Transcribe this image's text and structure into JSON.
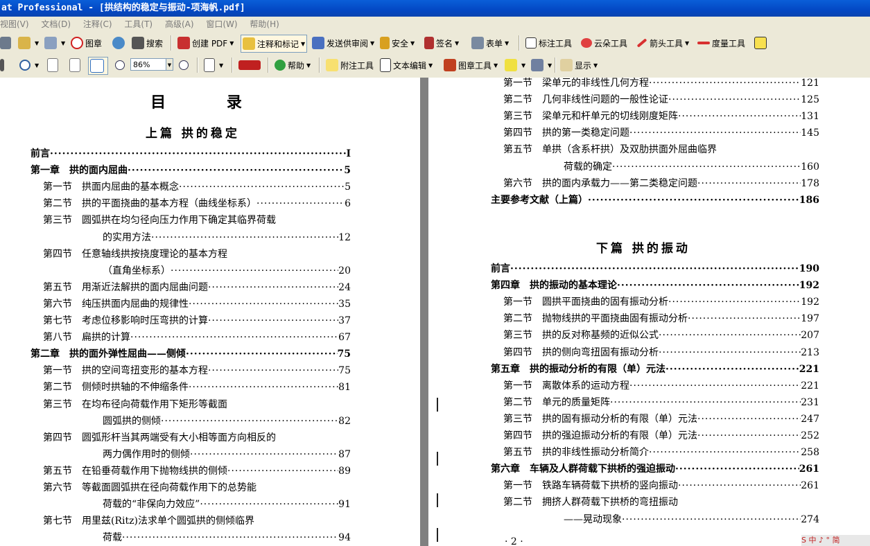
{
  "window": {
    "title": "at Professional - [拱结构的稳定与振动-项海帆.pdf]"
  },
  "menu": [
    "视图(V)",
    "文档(D)",
    "注释(C)",
    "工具(T)",
    "高级(A)",
    "窗口(W)",
    "帮助(H)"
  ],
  "toolbar1": {
    "stamp": "图章",
    "search": "搜索",
    "create_pdf": "创建 PDF",
    "comment_markup": "注释和标记",
    "send_review": "发送供审阅",
    "security": "安全",
    "sign": "签名",
    "forms": "表单",
    "callout": "标注工具",
    "cloud": "云朵工具",
    "arrow": "箭头工具",
    "measure": "度量工具"
  },
  "toolbar2": {
    "zoom_value": "86%",
    "help": "帮助",
    "note_tool": "附注工具",
    "text_edit": "文本编辑",
    "stamp_tool": "图章工具",
    "show": "显示"
  },
  "left_page": {
    "title": "目 录",
    "part_title": "上篇 拱的稳定",
    "entries": [
      {
        "label": "前言",
        "text": "",
        "page": "I",
        "bold": true
      },
      {
        "label": "第一章",
        "text": "拱的面内屈曲",
        "page": "5",
        "bold": true
      },
      {
        "label": "第一节",
        "text": "拱面内屈曲的基本概念",
        "page": "5"
      },
      {
        "label": "第二节",
        "text": "拱的平面挠曲的基本方程（曲线坐标系）",
        "page": "6"
      },
      {
        "label": "第三节",
        "text": "圆弧拱在均匀径向压力作用下确定其临界荷载",
        "page": ""
      },
      {
        "label": "",
        "text": "的实用方法",
        "page": "12"
      },
      {
        "label": "第四节",
        "text": "任意轴线拱按挠度理论的基本方程",
        "page": ""
      },
      {
        "label": "",
        "text": "（直角坐标系）",
        "page": "20"
      },
      {
        "label": "第五节",
        "text": "用渐近法解拱的面内屈曲问题",
        "page": "24"
      },
      {
        "label": "第六节",
        "text": "纯压拱面内屈曲的规律性",
        "page": "35"
      },
      {
        "label": "第七节",
        "text": "考虑位移影响时压弯拱的计算",
        "page": "37"
      },
      {
        "label": "第八节",
        "text": "扁拱的计算",
        "page": "67"
      },
      {
        "label": "第二章",
        "text": "拱的面外弹性屈曲——侧倾",
        "page": "75",
        "bold": true
      },
      {
        "label": "第一节",
        "text": "拱的空间弯扭变形的基本方程",
        "page": "75"
      },
      {
        "label": "第二节",
        "text": "侧倾时拱轴的不伸缩条件",
        "page": "81"
      },
      {
        "label": "第三节",
        "text": "在均布径向荷载作用下矩形等截面",
        "page": ""
      },
      {
        "label": "",
        "text": "圆弧拱的侧倾",
        "page": "82"
      },
      {
        "label": "第四节",
        "text": "圆弧形杆当其两端受有大小相等面方向相反的",
        "page": ""
      },
      {
        "label": "",
        "text": "两力偶作用时的侧倾",
        "page": "87"
      },
      {
        "label": "第五节",
        "text": "在铅垂荷载作用下抛物线拱的侧倾",
        "page": "89"
      },
      {
        "label": "第六节",
        "text": "等截面圆弧拱在径向荷载作用下的总势能",
        "page": ""
      },
      {
        "label": "",
        "text": "荷载的“非保向力效应”",
        "page": "91"
      },
      {
        "label": "第七节",
        "text": "用里兹(Ritz)法求单个圆弧拱的侧倾临界",
        "page": ""
      },
      {
        "label": "",
        "text": "荷载",
        "page": "94"
      }
    ]
  },
  "right_page": {
    "entries_top": [
      {
        "label": "第一节",
        "text": "梁单元的非线性几何方程",
        "page": "121"
      },
      {
        "label": "第二节",
        "text": "几何非线性问题的一般性论证",
        "page": "125"
      },
      {
        "label": "第三节",
        "text": "梁单元和杆单元的切线刚度矩阵",
        "page": "131"
      },
      {
        "label": "第四节",
        "text": "拱的第一类稳定问题",
        "page": "145"
      },
      {
        "label": "第五节",
        "text": "单拱（含系杆拱）及双肋拱面外屈曲临界",
        "page": ""
      },
      {
        "label": "",
        "text": "荷载的确定",
        "page": "160"
      },
      {
        "label": "第六节",
        "text": "拱的面内承载力——第二类稳定问题",
        "page": "178"
      },
      {
        "label": "主要参考文献（上篇）",
        "text": "",
        "page": "186",
        "bold": true
      }
    ],
    "part_title": "下篇 拱的振动",
    "entries_bottom": [
      {
        "label": "前言",
        "text": "",
        "page": "190",
        "bold": true
      },
      {
        "label": "第四章",
        "text": "拱的振动的基本理论",
        "page": "192",
        "bold": true
      },
      {
        "label": "第一节",
        "text": "圆拱平面挠曲的固有振动分析",
        "page": "192"
      },
      {
        "label": "第二节",
        "text": "抛物线拱的平面挠曲固有振动分析",
        "page": "197"
      },
      {
        "label": "第三节",
        "text": "拱的反对称基频的近似公式",
        "page": "207"
      },
      {
        "label": "第四节",
        "text": "拱的侧向弯扭固有振动分析",
        "page": "213"
      },
      {
        "label": "第五章",
        "text": "拱的振动分析的有限（单）元法",
        "page": "221",
        "bold": true
      },
      {
        "label": "第一节",
        "text": "离散体系的运动方程",
        "page": "221"
      },
      {
        "label": "第二节",
        "text": "单元的质量矩阵",
        "page": "231"
      },
      {
        "label": "第三节",
        "text": "拱的固有振动分析的有限（单）元法",
        "page": "247"
      },
      {
        "label": "第四节",
        "text": "拱的强迫振动分析的有限（单）元法",
        "page": "252"
      },
      {
        "label": "第五节",
        "text": "拱的非线性振动分析简介",
        "page": "258"
      },
      {
        "label": "第六章",
        "text": "车辆及人群荷载下拱桥的强迫振动",
        "page": "261",
        "bold": true
      },
      {
        "label": "第一节",
        "text": "铁路车辆荷载下拱桥的竖向振动",
        "page": "261"
      },
      {
        "label": "第二节",
        "text": "拥挤人群荷载下拱桥的弯扭振动",
        "page": ""
      },
      {
        "label": "",
        "text": "——晃动现象",
        "page": "274"
      }
    ],
    "page_number": "· 2 ·"
  },
  "tray": {
    "text": "S 中 ♪ ° 简"
  }
}
